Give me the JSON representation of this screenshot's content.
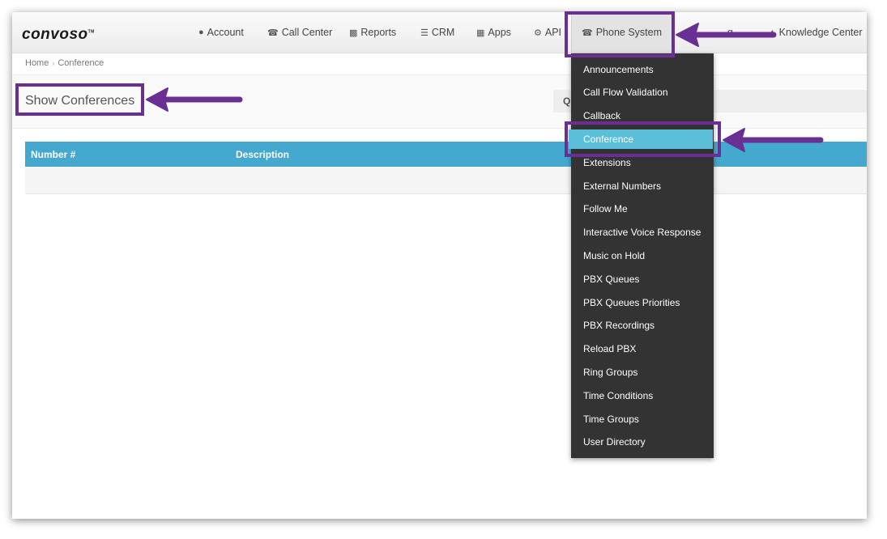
{
  "brand": {
    "logo": "convoso",
    "tm": "TM"
  },
  "nav": [
    {
      "label": "Account",
      "icon": "user-icon"
    },
    {
      "label": "Call Center",
      "icon": "phone-icon"
    },
    {
      "label": "Reports",
      "icon": "bar-chart-icon"
    },
    {
      "label": "CRM",
      "icon": "list-icon"
    },
    {
      "label": "Apps",
      "icon": "grid-icon"
    },
    {
      "label": "API",
      "icon": "gear-icon"
    },
    {
      "label": "Phone System",
      "icon": "phone-icon"
    }
  ],
  "nav_partial": {
    "left_fragment": "g",
    "right_label": "Knowledge Center"
  },
  "breadcrumb": {
    "home": "Home",
    "current": "Conference",
    "separator": "›"
  },
  "page_title": "Show Conferences",
  "search": {
    "icon": "search-icon"
  },
  "table": {
    "columns": [
      "Number #",
      "Description"
    ]
  },
  "dropdown": {
    "items": [
      "Announcements",
      "Call Flow Validation",
      "Callback",
      "Conference",
      "Extensions",
      "External Numbers",
      "Follow Me",
      "Interactive Voice Response",
      "Music on Hold",
      "PBX Queues",
      "PBX Queues Priorities",
      "PBX Recordings",
      "Reload PBX",
      "Ring Groups",
      "Time Conditions",
      "Time Groups",
      "User Directory"
    ],
    "active_index": 3
  },
  "colors": {
    "accent": "#45a9cf",
    "menu_active": "#5bbfda",
    "menu_bg": "#333333",
    "annotation": "#6a2f92"
  }
}
